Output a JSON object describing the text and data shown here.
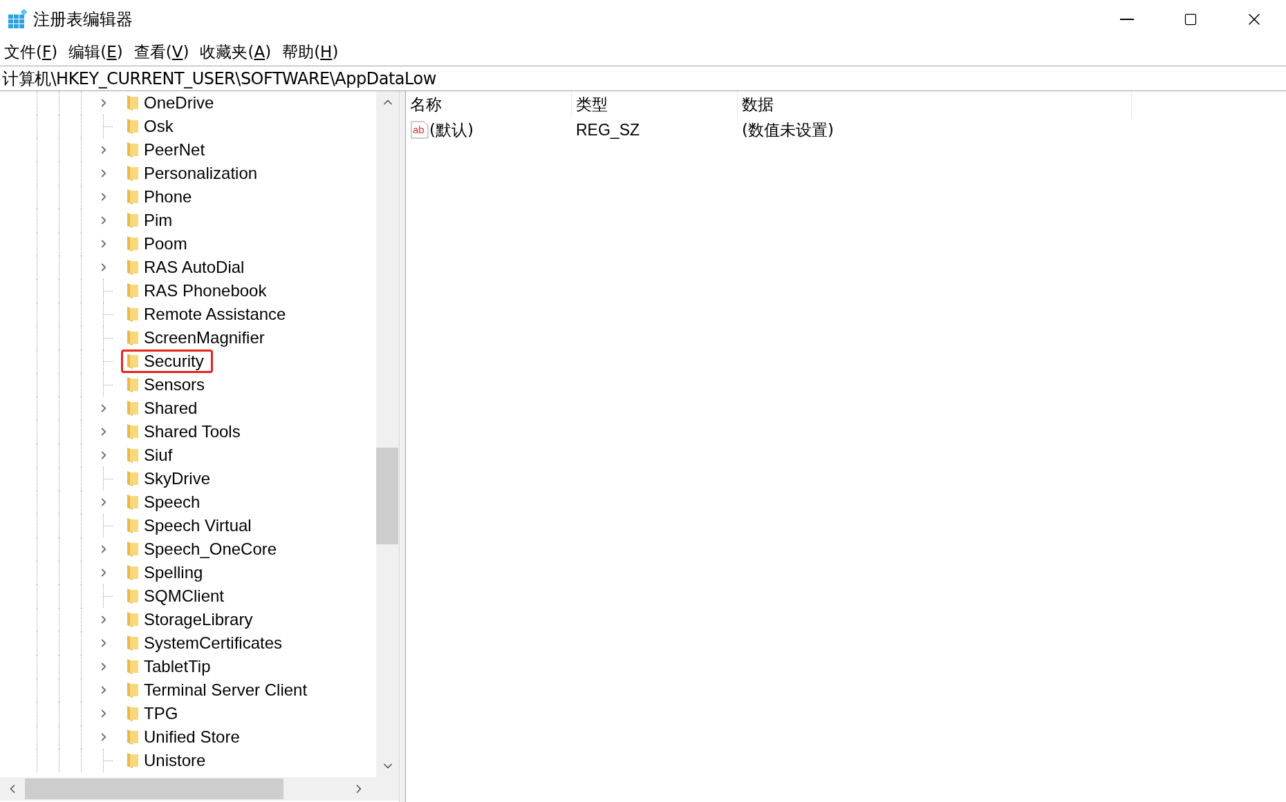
{
  "window": {
    "title": "注册表编辑器"
  },
  "menu": [
    {
      "before": "文件(",
      "key": "F",
      "after": ")"
    },
    {
      "before": "编辑(",
      "key": "E",
      "after": ")"
    },
    {
      "before": "查看(",
      "key": "V",
      "after": ")"
    },
    {
      "before": "收藏夹(",
      "key": "A",
      "after": ")"
    },
    {
      "before": "帮助(",
      "key": "H",
      "after": ")"
    }
  ],
  "address": "计算机\\HKEY_CURRENT_USER\\SOFTWARE\\AppDataLow",
  "tree": [
    {
      "label": "OneDrive",
      "expandable": true,
      "annotated": false
    },
    {
      "label": "Osk",
      "expandable": false,
      "annotated": false
    },
    {
      "label": "PeerNet",
      "expandable": true,
      "annotated": false
    },
    {
      "label": "Personalization",
      "expandable": true,
      "annotated": false
    },
    {
      "label": "Phone",
      "expandable": true,
      "annotated": false
    },
    {
      "label": "Pim",
      "expandable": true,
      "annotated": false
    },
    {
      "label": "Poom",
      "expandable": true,
      "annotated": false
    },
    {
      "label": "RAS AutoDial",
      "expandable": true,
      "annotated": false
    },
    {
      "label": "RAS Phonebook",
      "expandable": false,
      "annotated": false
    },
    {
      "label": "Remote Assistance",
      "expandable": false,
      "annotated": false
    },
    {
      "label": "ScreenMagnifier",
      "expandable": false,
      "annotated": false
    },
    {
      "label": "Security",
      "expandable": false,
      "annotated": true
    },
    {
      "label": "Sensors",
      "expandable": false,
      "annotated": false
    },
    {
      "label": "Shared",
      "expandable": true,
      "annotated": false
    },
    {
      "label": "Shared Tools",
      "expandable": true,
      "annotated": false
    },
    {
      "label": "Siuf",
      "expandable": true,
      "annotated": false
    },
    {
      "label": "SkyDrive",
      "expandable": false,
      "annotated": false
    },
    {
      "label": "Speech",
      "expandable": true,
      "annotated": false
    },
    {
      "label": "Speech Virtual",
      "expandable": false,
      "annotated": false
    },
    {
      "label": "Speech_OneCore",
      "expandable": true,
      "annotated": false
    },
    {
      "label": "Spelling",
      "expandable": true,
      "annotated": false
    },
    {
      "label": "SQMClient",
      "expandable": false,
      "annotated": false
    },
    {
      "label": "StorageLibrary",
      "expandable": true,
      "annotated": false
    },
    {
      "label": "SystemCertificates",
      "expandable": true,
      "annotated": false
    },
    {
      "label": "TabletTip",
      "expandable": true,
      "annotated": false
    },
    {
      "label": "Terminal Server Client",
      "expandable": true,
      "annotated": false
    },
    {
      "label": "TPG",
      "expandable": true,
      "annotated": false
    },
    {
      "label": "Unified Store",
      "expandable": true,
      "annotated": false
    },
    {
      "label": "Unistore",
      "expandable": false,
      "annotated": false
    }
  ],
  "table": {
    "columns": [
      "名称",
      "类型",
      "数据"
    ],
    "rows": [
      {
        "icon_label": "ab",
        "name": "(默认)",
        "type": "REG_SZ",
        "data": "(数值未设置)"
      }
    ]
  }
}
